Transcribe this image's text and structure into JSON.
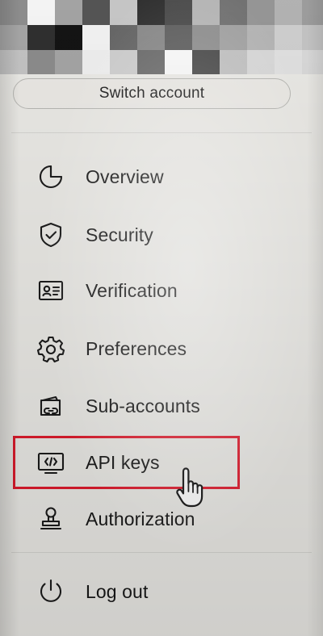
{
  "header": {
    "switch_account_label": "Switch account"
  },
  "menu": {
    "items": [
      {
        "label": "Overview",
        "icon": "pie-chart-icon"
      },
      {
        "label": "Security",
        "icon": "shield-check-icon"
      },
      {
        "label": "Verification",
        "icon": "id-card-icon"
      },
      {
        "label": "Preferences",
        "icon": "gear-icon"
      },
      {
        "label": "Sub-accounts",
        "icon": "wallet-link-icon"
      },
      {
        "label": "API keys",
        "icon": "api-monitor-icon"
      },
      {
        "label": "Authorization",
        "icon": "stamp-icon"
      }
    ],
    "logout_label": "Log out",
    "logout_icon": "power-icon"
  },
  "state": {
    "highlighted_item": "API keys",
    "highlight_color": "#e01b2d",
    "cursor": "pointer-hand-icon"
  }
}
